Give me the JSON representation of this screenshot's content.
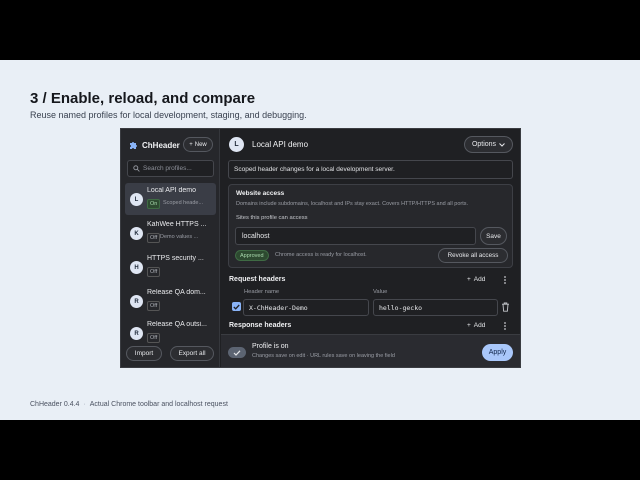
{
  "slide": {
    "title": "3 / Enable, reload, and compare",
    "subtitle": "Reuse named profiles for local development, staging, and debugging.",
    "footer_version": "ChHeader 0.4.4",
    "footer_sep": "·",
    "footer_caption": "Actual Chrome toolbar and localhost request"
  },
  "colors": {
    "accent": "#a9c7fa",
    "approved": "#a9d9ad",
    "checkbox": "#8ab4f8",
    "panel_bg": "#1f2023"
  },
  "sidebar": {
    "brand": "ChHeader",
    "brand_icon": "puzzle-icon",
    "new_label": "New",
    "search_placeholder": "Search profiles...",
    "profiles": [
      {
        "initial": "L",
        "name": "Local API demo",
        "badge": "On",
        "desc": "Scoped heade...",
        "active": true
      },
      {
        "initial": "K",
        "name": "KahWee HTTPS ...",
        "badge": "Off",
        "desc": "Demo values ...",
        "active": false
      },
      {
        "initial": "H",
        "name": "HTTPS security ...",
        "badge": "Off",
        "desc": "",
        "active": false
      },
      {
        "initial": "R",
        "name": "Release QA dom...",
        "badge": "Off",
        "desc": "",
        "active": false
      },
      {
        "initial": "R",
        "name": "Release QA outsi...",
        "badge": "Off",
        "desc": "",
        "active": false
      }
    ],
    "import_label": "Import",
    "export_label": "Export all"
  },
  "main": {
    "avatar_initial": "L",
    "title": "Local API demo",
    "options_label": "Options",
    "description": "Scoped header changes for a local development server.",
    "access": {
      "title": "Website access",
      "help": "Domains include subdomains, localhost and IPs stay exact. Covers HTTP/HTTPS and all ports.",
      "sites_label": "Sites this profile can access",
      "host_value": "localhost",
      "save_label": "Save",
      "approved_label": "Approved",
      "status_text": "Chrome access is ready for localhost.",
      "revoke_label": "Revoke all access"
    },
    "request_headers": {
      "title": "Request headers",
      "add_label": "Add",
      "col_name": "Header name",
      "col_value": "Value",
      "rows": [
        {
          "name": "X-ChHeader-Demo",
          "value": "hello-gecko",
          "enabled": true
        }
      ]
    },
    "response_headers": {
      "title": "Response headers",
      "add_label": "Add"
    },
    "footer": {
      "title": "Profile is on",
      "subtitle": "Changes save on edit · URL rules save on leaving the field",
      "apply_label": "Apply"
    }
  }
}
